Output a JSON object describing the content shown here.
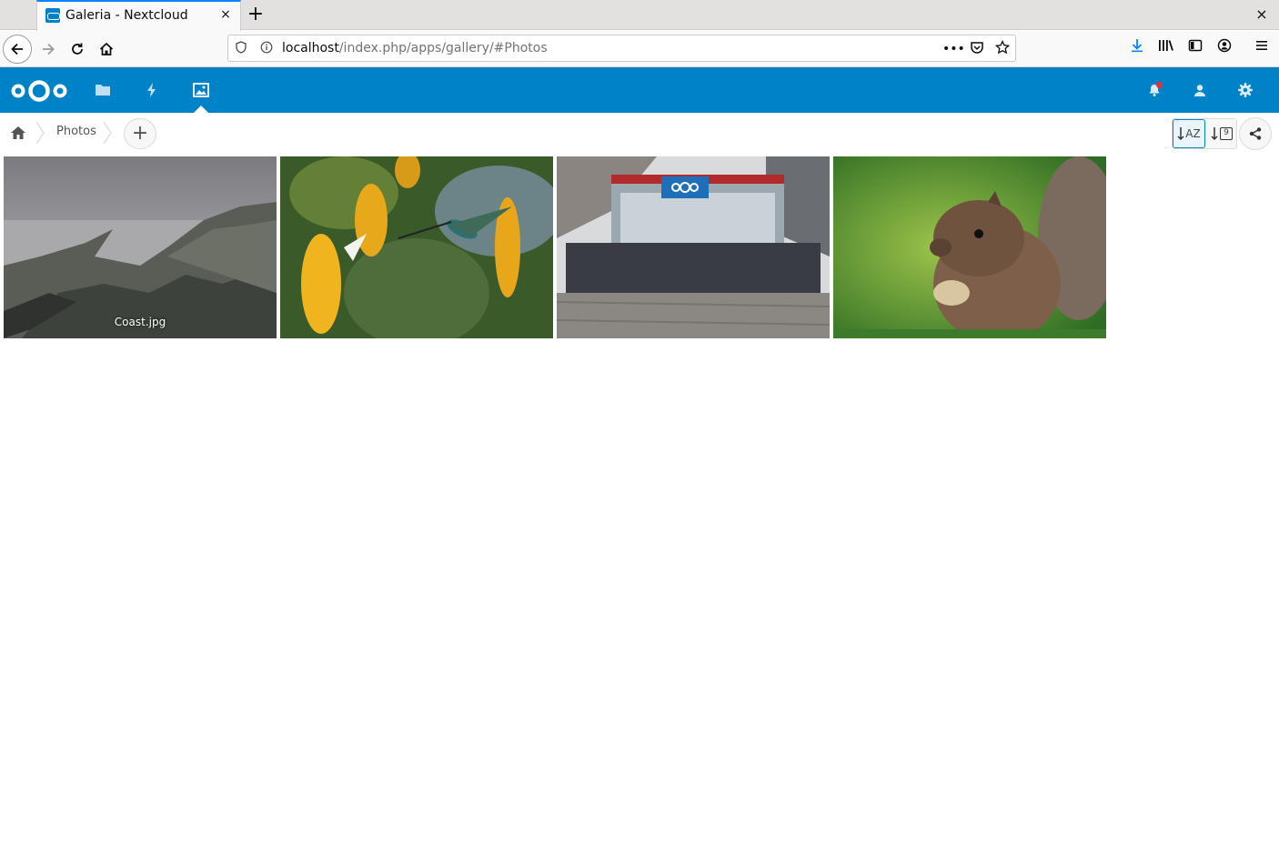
{
  "browser": {
    "tab_title": "Galeria - Nextcloud",
    "tab_close": "×",
    "new_tab": "+",
    "window_close": "×",
    "url_host": "localhost",
    "url_path": "/index.php/apps/gallery/#Photos",
    "more_actions": "•••"
  },
  "nextcloud": {
    "brand_color": "#0082c9",
    "apps": [
      "files-icon",
      "activity-icon",
      "gallery-icon"
    ],
    "active_app": "gallery",
    "right_icons": [
      "notifications-icon",
      "contacts-icon",
      "settings-icon"
    ]
  },
  "controls": {
    "breadcrumb_label": "Photos",
    "add_label": "+",
    "sort_name_label": "AZ",
    "sort_date_label": "9"
  },
  "gallery": {
    "photos": [
      {
        "name": "Coast.jpg",
        "caption_visible": "Coast.jpg",
        "subject": "coast"
      },
      {
        "name": "",
        "caption_visible": "",
        "subject": "hummingbird"
      },
      {
        "name": "",
        "caption_visible": "",
        "subject": "nextcloud-community"
      },
      {
        "name": "",
        "caption_visible": "",
        "subject": "squirrel"
      }
    ]
  }
}
